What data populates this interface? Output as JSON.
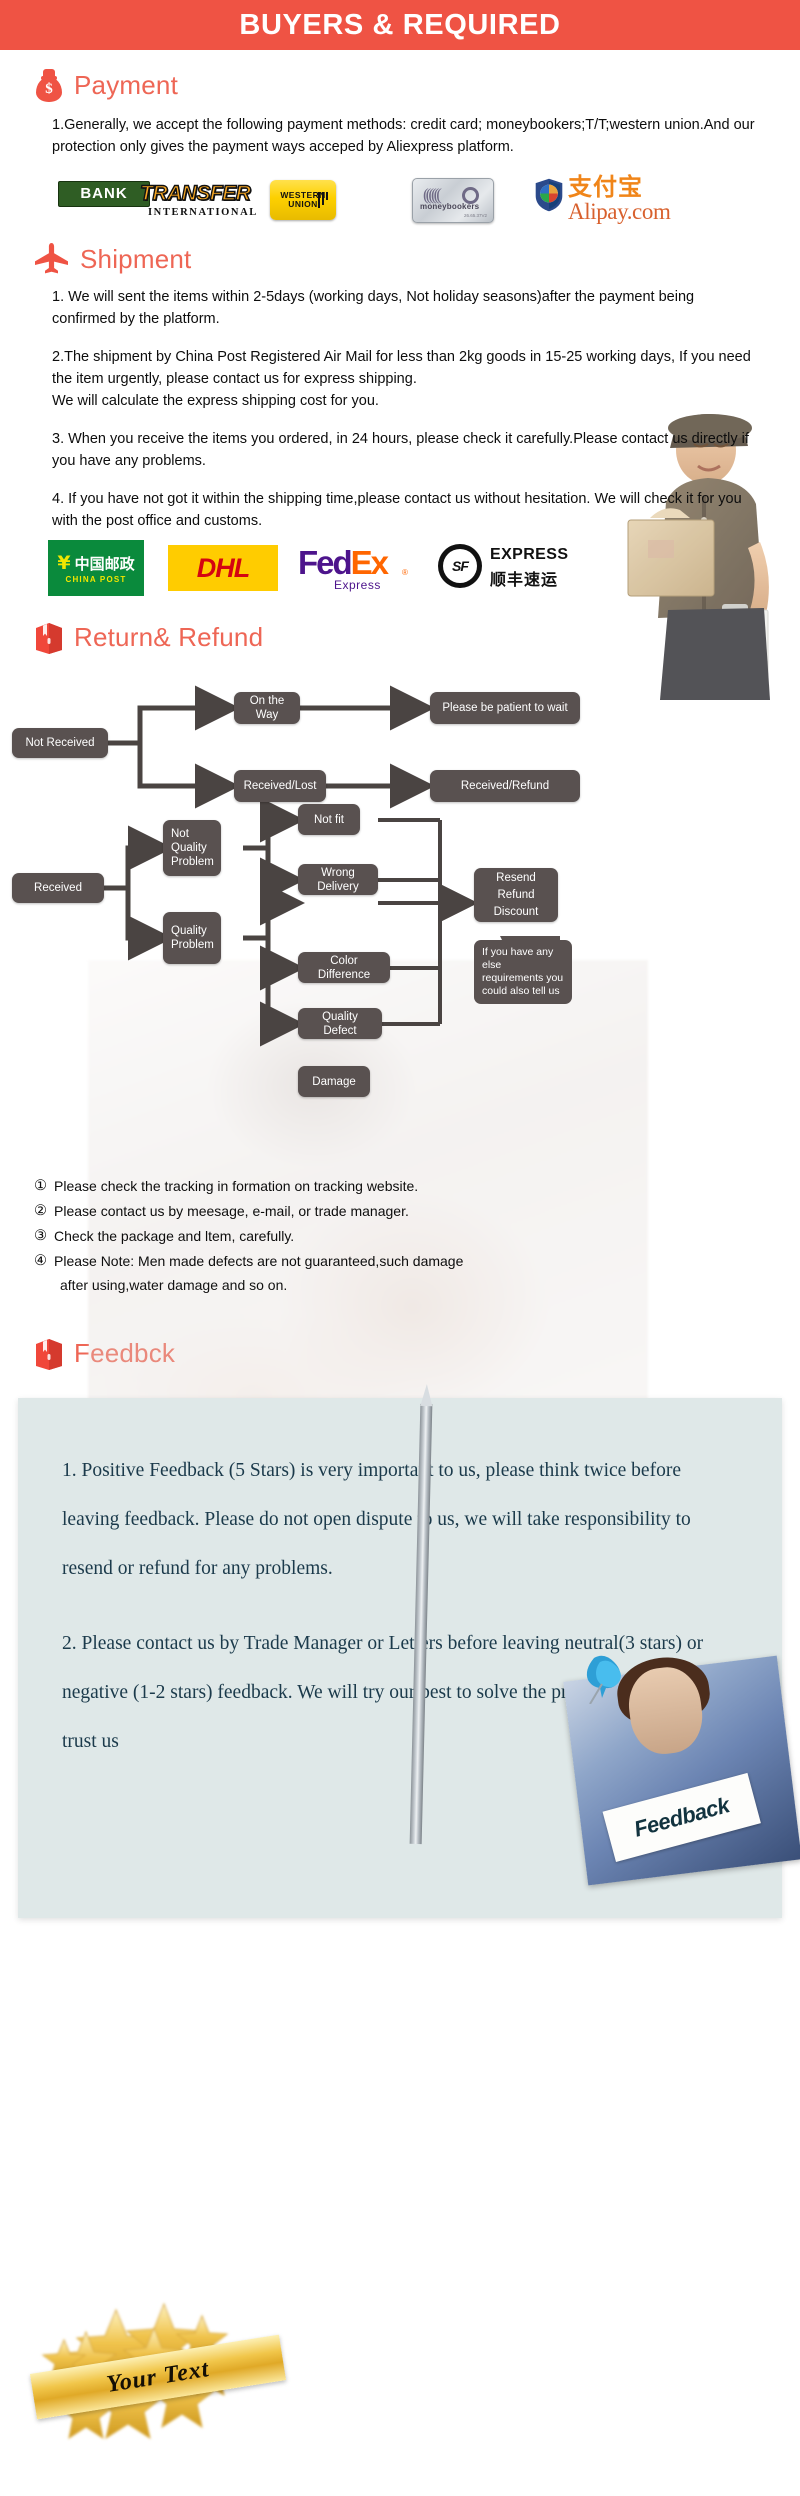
{
  "banner": {
    "title": "BUYERS & REQUIRED"
  },
  "payment": {
    "heading": "Payment",
    "icon": "money-bag-icon",
    "paragraph": "1.Generally, we accept the following payment methods: credit card; moneybookers;T/T;western union.And our protection only gives the payment ways acceped by Aliexpress platform.",
    "logos": [
      {
        "name": "bank-transfer-logo",
        "primary": "BANK",
        "secondary": "TRANSFER",
        "tertiary": "INTERNATIONAL"
      },
      {
        "name": "western-union-logo",
        "line1": "WESTERN",
        "line2": "UNION"
      },
      {
        "name": "moneybookers-logo",
        "label": "moneybookers",
        "tiny": "26.65.37V2"
      },
      {
        "name": "alipay-logo",
        "cn": "支付宝",
        "domain": "Alipay.com"
      }
    ]
  },
  "shipment": {
    "heading": "Shipment",
    "icon": "airplane-icon",
    "paragraphs": [
      "1. We will sent the items within 2-5days (working days, Not holiday seasons)after the payment being confirmed by the platform.",
      "2.The shipment by China Post Registered Air Mail for less than  2kg goods in 15-25 working days, If  you need the item urgently, please contact us for express shipping.\nWe will calculate the express shipping cost for you.",
      "3. When you receive the items you ordered, in 24 hours, please check it carefully.Please contact us directly if you have any problems.",
      "4. If you have not got it within the shipping time,please contact us without hesitation. We will check it for you with the post office and customs."
    ],
    "carriers": [
      {
        "name": "china-post-logo",
        "cn": "中国邮政",
        "en": "CHINA POST"
      },
      {
        "name": "dhl-logo",
        "label": "DHL"
      },
      {
        "name": "fedex-logo",
        "part1": "Fed",
        "part2": "Ex",
        "sub": "Express",
        "reg": "®"
      },
      {
        "name": "sf-express-logo",
        "mark": "SF",
        "en": "EXPRESS",
        "cn": "顺丰速运"
      }
    ]
  },
  "returns": {
    "heading": "Return& Refund",
    "icon": "package-box-icon",
    "flow": {
      "not_received": "Not Received",
      "on_the_way": "On the Way",
      "please_wait": "Please be patient to wait",
      "received_lost": "Received/Lost",
      "received_refund": "Received/Refund",
      "received": "Received",
      "not_quality_problem": "Not\nQuality\nProblem",
      "quality_problem": "Quality\nProblem",
      "not_fit": "Not fit",
      "wrong_delivery": "Wrong Delivery",
      "color_difference": "Color Difference",
      "quality_defect": "Quality Defect",
      "damage": "Damage",
      "resend_refund_discount": "Resend\nRefund\nDiscount",
      "callout": "If you have any else requirements you could also tell us"
    },
    "notes": [
      {
        "marker": "①",
        "text": "Please check the tracking in formation on tracking website."
      },
      {
        "marker": "②",
        "text": "Please contact us by meesage, e-mail, or trade manager."
      },
      {
        "marker": "③",
        "text": "Check the package and ltem, carefully."
      },
      {
        "marker": "④",
        "text": "Please Note: Men made defects  are not guaranteed,such damage",
        "cont": "after using,water damage and so on."
      }
    ]
  },
  "feedback": {
    "heading": "Feedbck",
    "icon": "package-box-icon",
    "photo_label": "Feedback",
    "paragraphs": [
      "1. Positive Feedback (5 Stars) is very important to us, please think twice before leaving feedback. Please do not open dispute to us,   we will take responsibility to resend or refund for any problems.",
      "2. Please contact us by Trade Manager or Letters before leaving neutral(3 stars) or negative (1-2 stars) feedback. We will try our best to solve the problems and please trust us"
    ],
    "badge": "Your Text"
  },
  "colors": {
    "banner_bg": "#ef5344",
    "heading": "#ee6655",
    "node_bg": "#595150",
    "panel_bg": "#dfe8e8",
    "panel_text": "#1b3a4b"
  }
}
